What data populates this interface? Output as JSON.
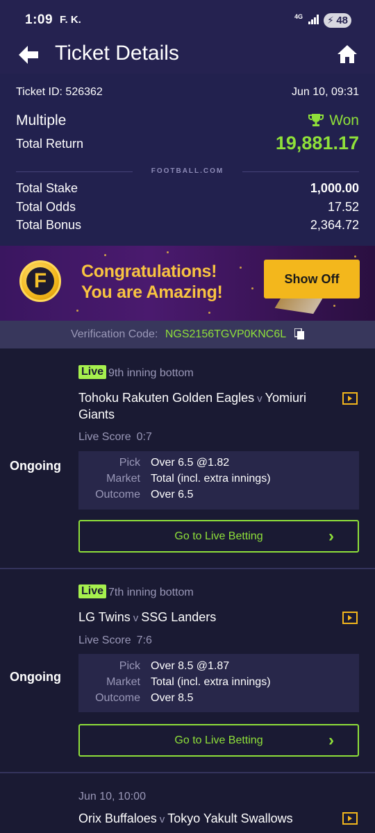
{
  "status_bar": {
    "time": "1:09",
    "apps": "F. K.",
    "network": "4G",
    "battery": "48"
  },
  "header": {
    "title": "Ticket Details"
  },
  "summary": {
    "ticket_id_label": "Ticket ID: 526362",
    "date": "Jun 10, 09:31",
    "type": "Multiple",
    "result": "Won",
    "total_return_label": "Total Return",
    "total_return": "19,881.17",
    "brand": "FOOTBALL.COM",
    "total_stake_label": "Total Stake",
    "total_stake": "1,000.00",
    "total_odds_label": "Total Odds",
    "total_odds": "17.52",
    "total_bonus_label": "Total Bonus",
    "total_bonus": "2,364.72"
  },
  "banner": {
    "line1": "Congratulations!",
    "line2": "You are Amazing!",
    "button": "Show Off"
  },
  "verification": {
    "label": "Verification Code:",
    "code": "NGS2156TGVP0KNC6L"
  },
  "bets": [
    {
      "status": "Ongoing",
      "live": "Live",
      "inning": "9th inning bottom",
      "home": "Tohoku Rakuten Golden Eagles",
      "vs": "v",
      "away": "Yomiuri Giants",
      "score_label": "Live Score",
      "score": "0:7",
      "pick_label": "Pick",
      "pick": "Over 6.5 @1.82",
      "market_label": "Market",
      "market": "Total (incl. extra innings)",
      "outcome_label": "Outcome",
      "outcome": "Over 6.5",
      "button": "Go to Live Betting"
    },
    {
      "status": "Ongoing",
      "live": "Live",
      "inning": "7th inning bottom",
      "home": "LG Twins",
      "vs": "v",
      "away": "SSG Landers",
      "score_label": "Live Score",
      "score": "7:6",
      "pick_label": "Pick",
      "pick": "Over 8.5 @1.87",
      "market_label": "Market",
      "market": "Total (incl. extra innings)",
      "outcome_label": "Outcome",
      "outcome": "Over 8.5",
      "button": "Go to Live Betting"
    },
    {
      "date": "Jun 10, 10:00",
      "home": "Orix Buffaloes",
      "vs": "v",
      "away": "Tokyo Yakult Swallows"
    }
  ],
  "colors": {
    "accent_green": "#8fe03a",
    "gold": "#f3b71c",
    "live_badge": "#a6f04e",
    "background": "#1a1a33"
  }
}
